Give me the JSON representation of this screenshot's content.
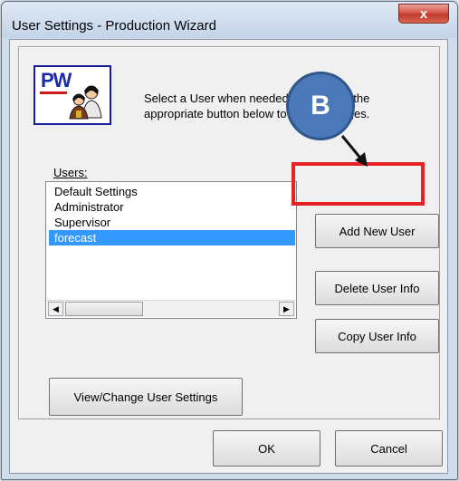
{
  "window": {
    "title": "User Settings - Production Wizard",
    "close_symbol": "x"
  },
  "logo": {
    "text": "PW",
    "icon": "users-logo-icon"
  },
  "intro_text": "Select a User when needed, then press the appropriate button below to make changes.",
  "users": {
    "label": "Users:",
    "items": [
      "Default Settings",
      "Administrator",
      "Supervisor",
      "forecast"
    ],
    "selected": "forecast"
  },
  "scrollbar": {
    "left_arrow": "◀",
    "right_arrow": "▶"
  },
  "buttons": {
    "add_new_user": "Add New User",
    "delete_user_info": "Delete User Info",
    "copy_user_info": "Copy User Info",
    "view_change_settings": "View/Change User Settings",
    "ok": "OK",
    "cancel": "Cancel"
  },
  "annotation": {
    "marker_label": "B",
    "marker_color": "#4a78b8",
    "highlight_color": "#e52225"
  }
}
